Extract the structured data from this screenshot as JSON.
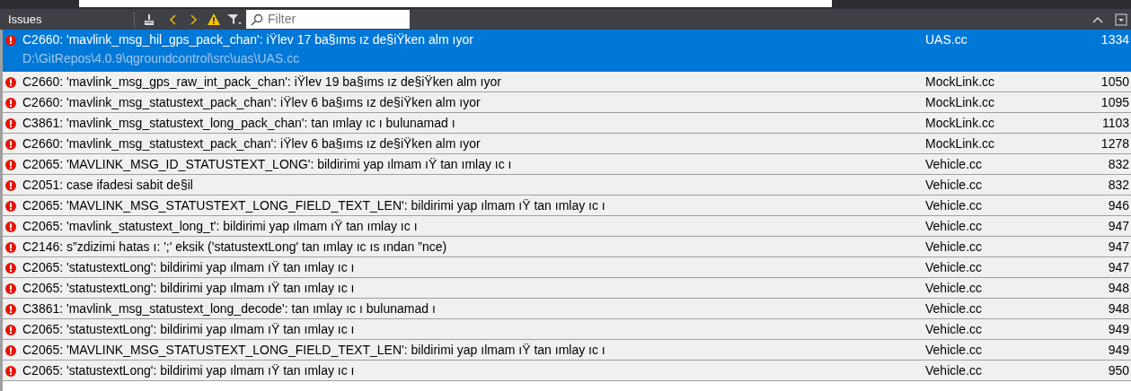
{
  "panel": {
    "title": "Issues",
    "filter": {
      "placeholder": "Filter"
    }
  },
  "issues": [
    {
      "message": "C2660: 'mavlink_msg_hil_gps_pack_chan': iŸlev 17 ba§ıms ız de§iŸken alm ıyor",
      "path": "D:\\GitRepos\\4.0.9\\qgroundcontrol\\src\\uas\\UAS.cc",
      "file": "UAS.cc",
      "line": "1334",
      "selected": true
    },
    {
      "message": "C2660: 'mavlink_msg_gps_raw_int_pack_chan': iŸlev 19 ba§ıms ız de§iŸken alm ıyor",
      "file": "MockLink.cc",
      "line": "1050",
      "selected": false
    },
    {
      "message": "C2660: 'mavlink_msg_statustext_pack_chan': iŸlev 6 ba§ıms ız de§iŸken alm ıyor",
      "file": "MockLink.cc",
      "line": "1095",
      "selected": false
    },
    {
      "message": "C3861: 'mavlink_msg_statustext_long_pack_chan': tan ımlay ıc ı bulunamad ı",
      "file": "MockLink.cc",
      "line": "1103",
      "selected": false
    },
    {
      "message": "C2660: 'mavlink_msg_statustext_pack_chan': iŸlev 6 ba§ıms ız de§iŸken alm ıyor",
      "file": "MockLink.cc",
      "line": "1278",
      "selected": false
    },
    {
      "message": "C2065: 'MAVLINK_MSG_ID_STATUSTEXT_LONG': bildirimi yap ılmam ıŸ tan ımlay ıc ı",
      "file": "Vehicle.cc",
      "line": "832",
      "selected": false
    },
    {
      "message": "C2051: case ifadesi sabit de§il",
      "file": "Vehicle.cc",
      "line": "832",
      "selected": false
    },
    {
      "message": "C2065: 'MAVLINK_MSG_STATUSTEXT_LONG_FIELD_TEXT_LEN': bildirimi yap ılmam ıŸ tan ımlay ıc ı",
      "file": "Vehicle.cc",
      "line": "946",
      "selected": false
    },
    {
      "message": "C2065: 'mavlink_statustext_long_t': bildirimi yap ılmam ıŸ tan ımlay ıc ı",
      "file": "Vehicle.cc",
      "line": "947",
      "selected": false
    },
    {
      "message": "C2146: s”zdizimi hatas ı: ';' eksik ('statustextLong' tan ımlay ıc ıs ından ”nce)",
      "file": "Vehicle.cc",
      "line": "947",
      "selected": false
    },
    {
      "message": "C2065: 'statustextLong': bildirimi yap ılmam ıŸ tan ımlay ıc ı",
      "file": "Vehicle.cc",
      "line": "947",
      "selected": false
    },
    {
      "message": "C2065: 'statustextLong': bildirimi yap ılmam ıŸ tan ımlay ıc ı",
      "file": "Vehicle.cc",
      "line": "948",
      "selected": false
    },
    {
      "message": "C3861: 'mavlink_msg_statustext_long_decode': tan ımlay ıc ı bulunamad ı",
      "file": "Vehicle.cc",
      "line": "948",
      "selected": false
    },
    {
      "message": "C2065: 'statustextLong': bildirimi yap ılmam ıŸ tan ımlay ıc ı",
      "file": "Vehicle.cc",
      "line": "949",
      "selected": false
    },
    {
      "message": "C2065: 'MAVLINK_MSG_STATUSTEXT_LONG_FIELD_TEXT_LEN': bildirimi yap ılmam ıŸ tan ımlay ıc ı",
      "file": "Vehicle.cc",
      "line": "949",
      "selected": false
    },
    {
      "message": "C2065: 'statustextLong': bildirimi yap ılmam ıŸ tan ımlay ıc ı",
      "file": "Vehicle.cc",
      "line": "950",
      "selected": false
    }
  ]
}
